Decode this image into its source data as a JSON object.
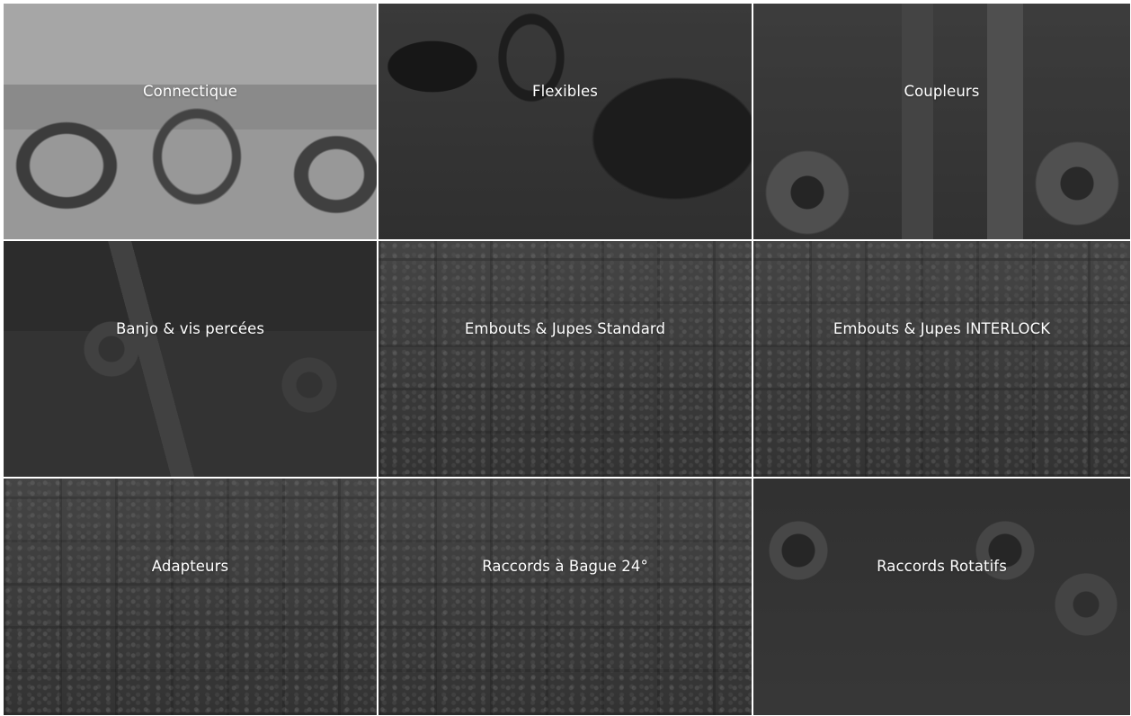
{
  "categories": [
    {
      "label": "Connectique"
    },
    {
      "label": "Flexibles"
    },
    {
      "label": "Coupleurs"
    },
    {
      "label": "Banjo & vis percées"
    },
    {
      "label": "Embouts & Jupes Standard"
    },
    {
      "label": "Embouts & Jupes INTERLOCK"
    },
    {
      "label": "Adapteurs"
    },
    {
      "label": "Raccords à Bague 24°"
    },
    {
      "label": "Raccords Rotatifs"
    }
  ],
  "colors": {
    "overlay": "#3a3a3a",
    "text": "#ffffff",
    "divider": "#ffffff"
  }
}
